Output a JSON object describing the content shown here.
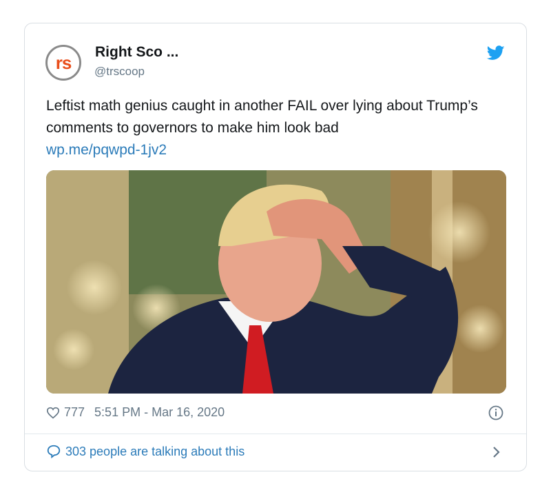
{
  "tweet": {
    "author_name": "Right Sco ...",
    "author_handle": "@trscoop",
    "avatar_text_r": "r",
    "avatar_text_s": "s",
    "text": "Leftist math genius caught in another FAIL over lying about Trump’s comments to governors to make him look bad",
    "link": "wp.me/pqwpd-1jv2",
    "likes": "777",
    "timestamp": "5:51 PM - Mar 16, 2020",
    "talking": "303 people are talking about this"
  },
  "colors": {
    "accent": "#1da1f2",
    "link": "#2b7bb9",
    "muted": "#657786",
    "text": "#14171a",
    "avatar_brand": "#e94e1b"
  },
  "icons": [
    "twitter-bird-icon",
    "heart-icon",
    "info-icon",
    "comment-bubble-icon",
    "chevron-right-icon"
  ]
}
